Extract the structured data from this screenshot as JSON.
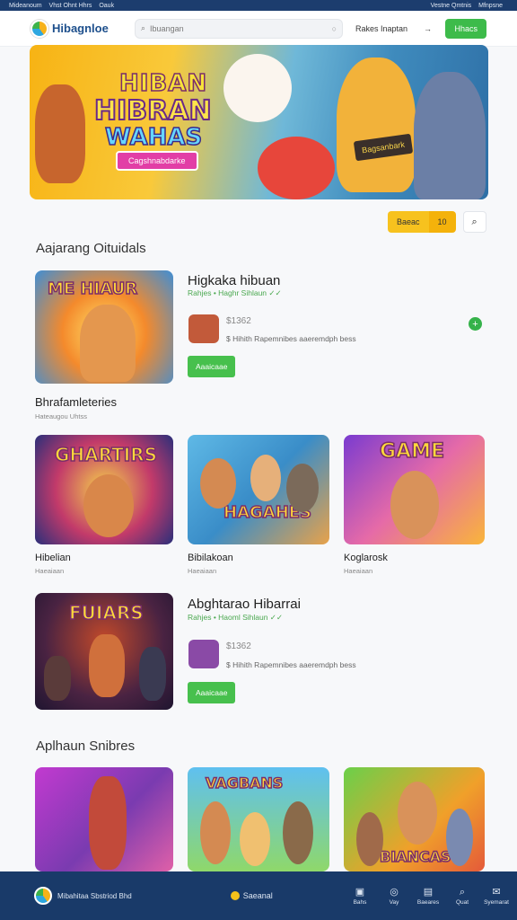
{
  "topbar": {
    "left": [
      "Mideanoum",
      "Vhst Ohnt Hhrs",
      "Oauk"
    ],
    "right": [
      "Vestne Qmtnis",
      "Mfnpsne"
    ]
  },
  "header": {
    "logo": "Hibagnloe",
    "search_placeholder": "Ibuangan",
    "login_label": "Rakes Inaptan",
    "arrow": "→",
    "cta_label": "Hhacs"
  },
  "hero": {
    "line1": "HIBAN",
    "line2": "HIBRAN",
    "line3": "WAHAS",
    "button": "Cagshnabdarke",
    "sign": "Bagsanbark"
  },
  "toolbar": {
    "segment_a": "Baeac",
    "segment_b": "10"
  },
  "sections": {
    "s1": "Aajarang Oituidals",
    "s2": "Aplhaun Snibres"
  },
  "featured": [
    {
      "thumb_word": "ME HIAUR",
      "title": "Higkaka hibuan",
      "meta": "Rahjes • Haghr Sihlaun ✓✓",
      "price": "$1362",
      "desc": "$ Hihith Rapemnibes aaeremdph bess",
      "button": "Aaaicaae"
    },
    {
      "thumb_word": "FUIARS",
      "title": "Abghtarao Hibarrai",
      "meta": "Rahjes • Haoml Sihlaun ✓✓",
      "price": "$1362",
      "desc": "$ Hihith Rapemnibes aaeremdph bess",
      "button": "Aaaicaae"
    }
  ],
  "label_block": {
    "title": "Bhrafamleteries",
    "sub": "Hateaugou Uhtss"
  },
  "grid": [
    {
      "word": "GHARTIRS",
      "label": "Hibelian",
      "sub": "Haeaiaan"
    },
    {
      "word": "HAGAHES",
      "label": "Bibilakoan",
      "sub": "Haeaiaan"
    },
    {
      "word": "GAME",
      "label": "Koglarosk",
      "sub": "Haeaiaan"
    }
  ],
  "grid2": [
    {
      "word": ""
    },
    {
      "word": "VAGBANS"
    },
    {
      "word": "BIANCAS"
    }
  ],
  "bottom": {
    "brand": "Mibahitaa Sbstriod Bhd",
    "mid": "Saeanal",
    "nav": [
      "Bahs",
      "Vay",
      "Baeares",
      "Quat",
      "Syemarat"
    ]
  }
}
